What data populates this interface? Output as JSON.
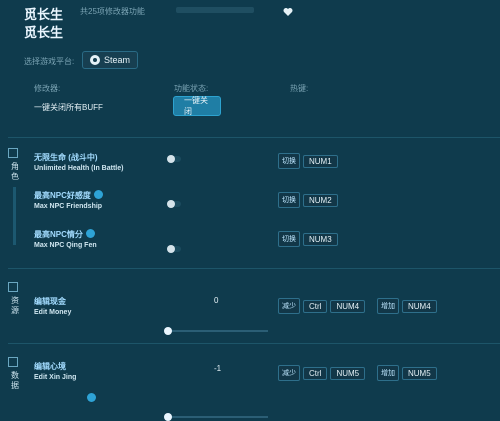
{
  "app": {
    "title": "觅长生",
    "meta": "共25项修改器功能",
    "subtitle": "觅长生"
  },
  "platform": {
    "label": "选择游戏平台:",
    "selected": "Steam"
  },
  "columns": {
    "modifier": "修改器:",
    "status": "功能状态:",
    "hotkey": "热键:"
  },
  "global": {
    "row_label": "一键关闭所有BUFF",
    "button": "一键关闭"
  },
  "sections": {
    "character": {
      "label": "角色"
    },
    "resources": {
      "label": "资源"
    },
    "data": {
      "label": "数据"
    }
  },
  "features": [
    {
      "cn": "无限生命 (战斗中)",
      "en": "Unlimited Health (In Battle)",
      "action": "切换",
      "keys": [
        "NUM1"
      ]
    },
    {
      "cn": "最高NPC好感度",
      "en": "Max NPC Friendship",
      "action": "切换",
      "keys": [
        "NUM2"
      ]
    },
    {
      "cn": "最高NPC情分",
      "en": "Max NPC Qing Fen",
      "action": "切换",
      "keys": [
        "NUM3"
      ]
    }
  ],
  "sliders": [
    {
      "cn": "编辑现金",
      "en": "Edit Money",
      "value": "0",
      "dec_action": "减少",
      "dec_keys": [
        "Ctrl",
        "NUM4"
      ],
      "inc_action": "增加",
      "inc_keys": [
        "NUM4"
      ]
    },
    {
      "cn": "编辑心境",
      "en": "Edit Xin Jing",
      "value": "-1",
      "dec_action": "减少",
      "dec_keys": [
        "Ctrl",
        "NUM5"
      ],
      "inc_action": "增加",
      "inc_keys": [
        "NUM5"
      ]
    }
  ],
  "icons": {
    "heart": "heart-icon",
    "steam": "steam-icon",
    "star": "star-icon",
    "section_character": "character-icon",
    "section_resources": "resources-icon",
    "section_data": "data-icon"
  },
  "colors": {
    "background": "#0f3b4d",
    "accent": "#1f7ea5"
  }
}
